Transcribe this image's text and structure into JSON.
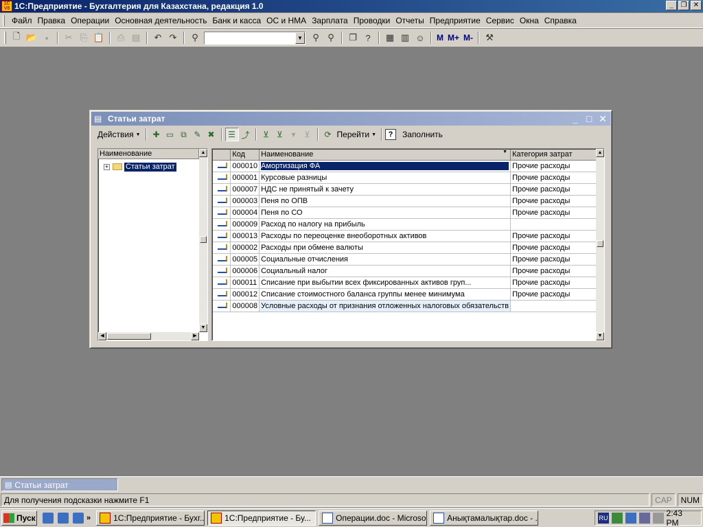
{
  "app": {
    "title": "1С:Предприятие - Бухгалтерия для Казахстана, редакция 1.0",
    "logo_text_top": "1С",
    "logo_text_bottom": "V8"
  },
  "menu": [
    "Файл",
    "Правка",
    "Операции",
    "Основная деятельность",
    "Банк и касса",
    "ОС и НМА",
    "Зарплата",
    "Проводки",
    "Отчеты",
    "Предприятие",
    "Сервис",
    "Окна",
    "Справка"
  ],
  "toolbar": {
    "search_value": "",
    "m_buttons": [
      "M",
      "M+",
      "M-"
    ]
  },
  "child_window": {
    "title": "Статьи затрат",
    "actions_label": "Действия",
    "goto_label": "Перейти",
    "fill_label": "Заполнить",
    "help_label": "?"
  },
  "tree": {
    "header": "Наименование",
    "root_item": "Статьи затрат"
  },
  "table": {
    "columns": [
      "Код",
      "Наименование",
      "Категория затрат"
    ],
    "rows": [
      {
        "code": "000010",
        "name": "Амортизация ФА",
        "category": "Прочие расходы"
      },
      {
        "code": "000001",
        "name": "Курсовые разницы",
        "category": "Прочие расходы"
      },
      {
        "code": "000007",
        "name": "НДС не принятый к зачету",
        "category": "Прочие расходы"
      },
      {
        "code": "000003",
        "name": "Пеня по ОПВ",
        "category": "Прочие расходы"
      },
      {
        "code": "000004",
        "name": "Пеня по СО",
        "category": "Прочие расходы"
      },
      {
        "code": "000009",
        "name": "Расход по налогу на прибыль",
        "category": ""
      },
      {
        "code": "000013",
        "name": "Расходы по переоценке внеоборотных активов",
        "category": "Прочие расходы"
      },
      {
        "code": "000002",
        "name": "Расходы при обмене валюты",
        "category": "Прочие расходы"
      },
      {
        "code": "000005",
        "name": "Социальные отчисления",
        "category": "Прочие расходы"
      },
      {
        "code": "000006",
        "name": "Социальный налог",
        "category": "Прочие расходы"
      },
      {
        "code": "000011",
        "name": "Списание при выбытии всех фиксированных активов груп...",
        "category": "Прочие расходы"
      },
      {
        "code": "000012",
        "name": "Списание стоимостного баланса группы менее минимума",
        "category": "Прочие расходы"
      },
      {
        "code": "000008",
        "name": "Условные расходы от признания отложенных налоговых обязательств",
        "category": ""
      }
    ]
  },
  "window_bar": {
    "tab": "Статьи затрат"
  },
  "status": {
    "hint": "Для получения подсказки нажмите F1",
    "cap": "CAP",
    "num": "NUM"
  },
  "taskbar": {
    "start": "Пуск",
    "more": "»",
    "tasks": [
      {
        "label": "1С:Предприятие - Бухг...",
        "icon": "1c",
        "active": false
      },
      {
        "label": "1С:Предприятие - Бу...",
        "icon": "1c",
        "active": true
      },
      {
        "label": "Операции.doc - Microso...",
        "icon": "word",
        "active": false
      },
      {
        "label": "Анықтамалықтар.doc - ...",
        "icon": "word",
        "active": false
      }
    ],
    "lang": "RU",
    "clock": "2:43 PM"
  }
}
